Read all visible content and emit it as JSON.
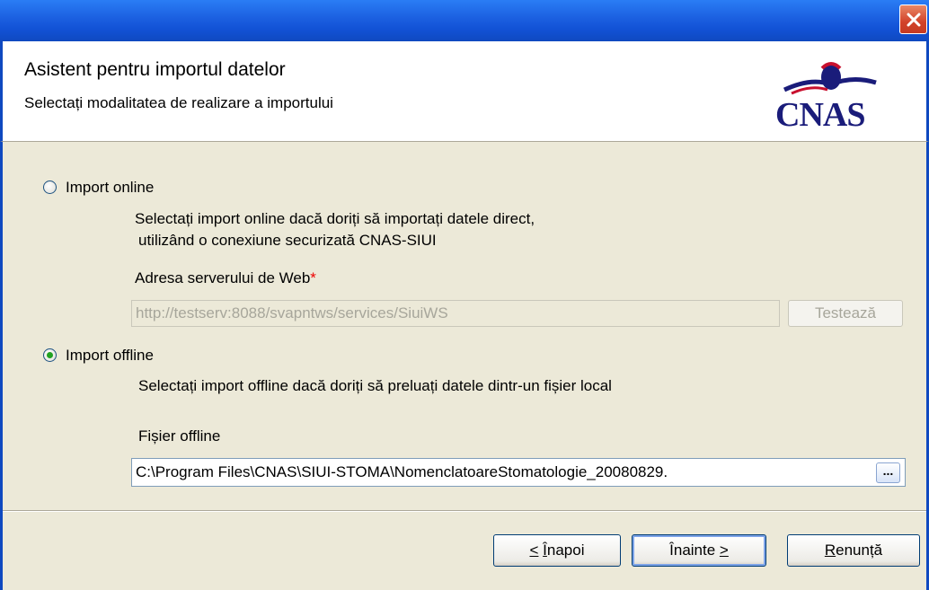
{
  "window": {
    "close_icon": "close-x-icon",
    "accent": "#0f49c0",
    "close_color": "#d2422a"
  },
  "header": {
    "title": "Asistent pentru importul datelor",
    "subtitle": "Selectați modalitatea de realizare a importului",
    "logo_text": "CNAS",
    "logo_color": "#1a1c7a"
  },
  "online": {
    "label": "Import online",
    "checked": false,
    "description_line1": "Selectați import online dacă doriți să importați datele direct,",
    "description_line2": "utilizând o conexiune securizată CNAS-SIUI",
    "server_label": "Adresa serverului de Web",
    "required_mark": "*",
    "server_url": "http://testserv:8088/svapntws/services/SiuiWS",
    "test_button": "Testează"
  },
  "offline": {
    "label": "Import offline",
    "checked": true,
    "description": "Selectați import offline dacă doriți să preluați datele dintr-un fișier local",
    "file_label": "Fișier offline",
    "file_path": "C:\\Program Files\\CNAS\\SIUI-STOMA\\NomenclatoareStomatologie_20080829.",
    "browse_button": "..."
  },
  "footer": {
    "back_key": "Î",
    "back_rest": "napoi",
    "back_prefix": "<",
    "next_text": "Înainte",
    "next_suffix": ">",
    "cancel_key": "R",
    "cancel_rest": "enunță"
  }
}
